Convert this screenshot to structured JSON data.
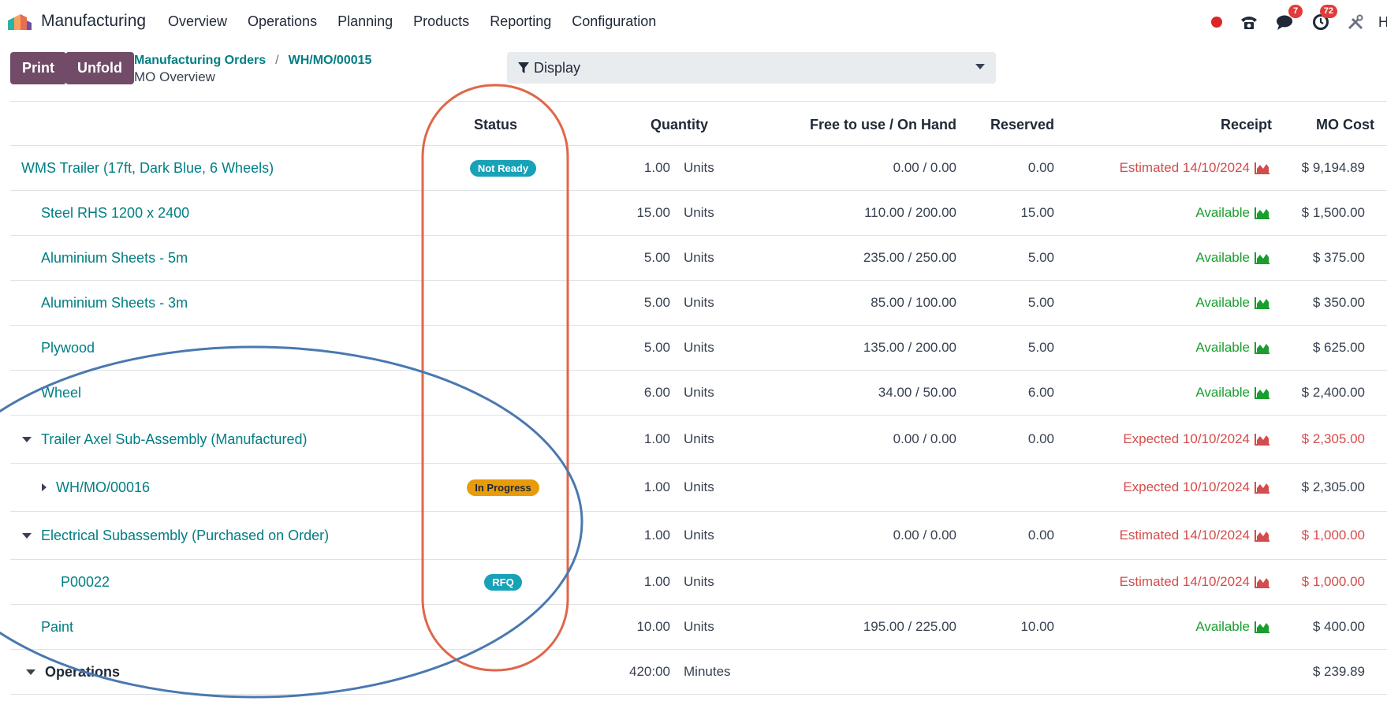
{
  "navbar": {
    "app_name": "Manufacturing",
    "menu": [
      "Overview",
      "Operations",
      "Planning",
      "Products",
      "Reporting",
      "Configuration"
    ],
    "messages_count": "7",
    "activities_count": "72",
    "user_initial": "H"
  },
  "controls": {
    "print_label": "Print",
    "unfold_label": "Unfold",
    "breadcrumb_parent": "Manufacturing Orders",
    "breadcrumb_separator": "/",
    "breadcrumb_current": "WH/MO/00015",
    "subtitle": "MO Overview",
    "display_label": "Display"
  },
  "colors": {
    "brand": "#714b67",
    "link": "#017e84",
    "badge_blue": "#17a2b8",
    "badge_orange": "#e89c0c",
    "red": "#d44c4c",
    "green": "#1a9e2e",
    "annotation_orange": "#e0664a",
    "annotation_blue": "#4a78b0"
  },
  "table": {
    "headers": {
      "status": "Status",
      "quantity": "Quantity",
      "free_on_hand": "Free to use / On Hand",
      "reserved": "Reserved",
      "receipt": "Receipt",
      "mo_cost": "MO Cost"
    },
    "rows": [
      {
        "name": "WMS Trailer (17ft, Dark Blue, 6 Wheels)",
        "status": "Not Ready",
        "qty": "1.00",
        "uom": "Units",
        "free": "0.00 / 0.00",
        "reserved": "0.00",
        "receipt": "Estimated 14/10/2024",
        "cost": "$ 9,194.89"
      },
      {
        "name": "Steel RHS 1200 x 2400",
        "status": "",
        "qty": "15.00",
        "uom": "Units",
        "free": "110.00 / 200.00",
        "reserved": "15.00",
        "receipt": "Available",
        "cost": "$ 1,500.00"
      },
      {
        "name": "Aluminium Sheets - 5m",
        "status": "",
        "qty": "5.00",
        "uom": "Units",
        "free": "235.00 / 250.00",
        "reserved": "5.00",
        "receipt": "Available",
        "cost": "$ 375.00"
      },
      {
        "name": "Aluminium Sheets - 3m",
        "status": "",
        "qty": "5.00",
        "uom": "Units",
        "free": "85.00 / 100.00",
        "reserved": "5.00",
        "receipt": "Available",
        "cost": "$ 350.00"
      },
      {
        "name": "Plywood",
        "status": "",
        "qty": "5.00",
        "uom": "Units",
        "free": "135.00 / 200.00",
        "reserved": "5.00",
        "receipt": "Available",
        "cost": "$ 625.00"
      },
      {
        "name": "Wheel",
        "status": "",
        "qty": "6.00",
        "uom": "Units",
        "free": "34.00 / 50.00",
        "reserved": "6.00",
        "receipt": "Available",
        "cost": "$ 2,400.00"
      },
      {
        "name": "Trailer Axel Sub-Assembly (Manufactured)",
        "status": "",
        "qty": "1.00",
        "uom": "Units",
        "free": "0.00 / 0.00",
        "reserved": "0.00",
        "receipt": "Expected 10/10/2024",
        "cost": "$ 2,305.00"
      },
      {
        "name": "WH/MO/00016",
        "status": "In Progress",
        "qty": "1.00",
        "uom": "Units",
        "free": "",
        "reserved": "",
        "receipt": "Expected 10/10/2024",
        "cost": "$ 2,305.00"
      },
      {
        "name": "Electrical Subassembly (Purchased on Order)",
        "status": "",
        "qty": "1.00",
        "uom": "Units",
        "free": "0.00 / 0.00",
        "reserved": "0.00",
        "receipt": "Estimated 14/10/2024",
        "cost": "$ 1,000.00"
      },
      {
        "name": "P00022",
        "status": "RFQ",
        "qty": "1.00",
        "uom": "Units",
        "free": "",
        "reserved": "",
        "receipt": "Estimated 14/10/2024",
        "cost": "$ 1,000.00"
      },
      {
        "name": "Paint",
        "status": "",
        "qty": "10.00",
        "uom": "Units",
        "free": "195.00 / 225.00",
        "reserved": "10.00",
        "receipt": "Available",
        "cost": "$ 400.00"
      },
      {
        "name": "Operations",
        "status": "",
        "qty": "420:00",
        "uom": "Minutes",
        "free": "",
        "reserved": "",
        "receipt": "",
        "cost": "$ 239.89"
      }
    ]
  }
}
